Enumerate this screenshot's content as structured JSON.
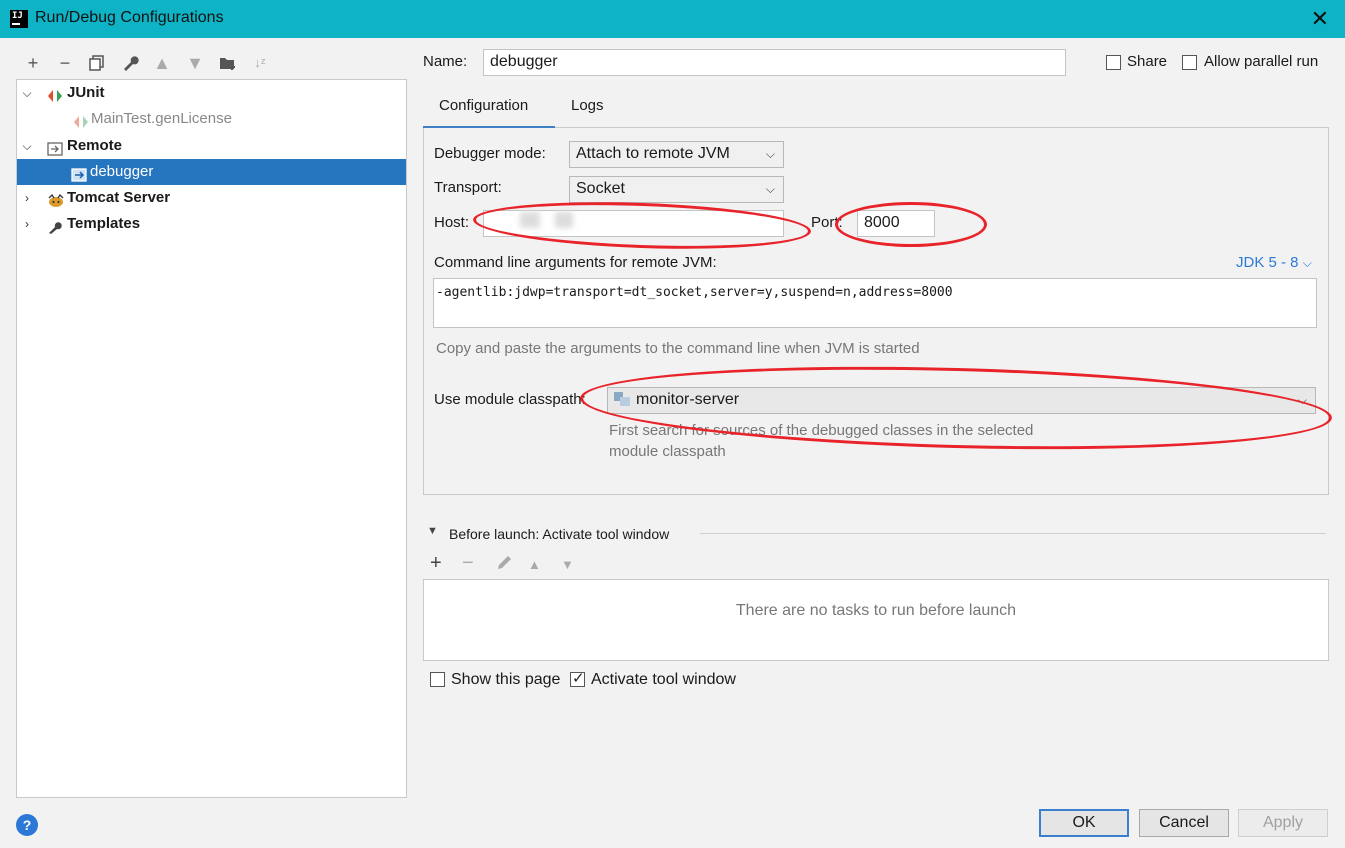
{
  "window": {
    "title": "Run/Debug Configurations",
    "app_icon": "IJ"
  },
  "left_toolbar": {
    "icons": [
      "add-icon",
      "remove-icon",
      "copy-icon",
      "wrench-icon",
      "move-up-icon",
      "move-down-icon",
      "folder-add-icon",
      "sort-icon"
    ]
  },
  "tree": {
    "items": [
      {
        "label": "JUnit",
        "bold": true,
        "expanded": true,
        "icon": "junit-icon"
      },
      {
        "label": "MainTest.genLicense",
        "bold": false,
        "icon": "junit-test-icon"
      },
      {
        "label": "Remote",
        "bold": true,
        "expanded": true,
        "icon": "remote-icon"
      },
      {
        "label": "debugger",
        "bold": false,
        "selected": true,
        "icon": "remote-config-icon"
      },
      {
        "label": "Tomcat Server",
        "bold": true,
        "expanded": false,
        "icon": "tomcat-icon"
      },
      {
        "label": "Templates",
        "bold": true,
        "expanded": false,
        "icon": "wrench-icon"
      }
    ]
  },
  "name_field": {
    "label": "Name:",
    "value": "debugger"
  },
  "share": {
    "label": "Share",
    "checked": false
  },
  "parallel": {
    "label": "Allow parallel run",
    "checked": false
  },
  "tabs": [
    {
      "label": "Configuration",
      "active": true
    },
    {
      "label": "Logs",
      "active": false
    }
  ],
  "config": {
    "debugger_mode_label": "Debugger mode:",
    "debugger_mode_value": "Attach to remote JVM",
    "transport_label": "Transport:",
    "transport_value": "Socket",
    "host_label": "Host:",
    "host_value": "",
    "port_label": "Port:",
    "port_value": "8000",
    "cmd_label": "Command line arguments for remote JVM:",
    "jdk_link": "JDK 5 - 8",
    "cmd_value": "-agentlib:jdwp=transport=dt_socket,server=y,suspend=n,address=8000",
    "cmd_hint": "Copy and paste the arguments to the command line when JVM is started",
    "module_label": "Use module classpath:",
    "module_value": "monitor-server",
    "module_hint_1": "First search for sources of the debugged classes in the selected",
    "module_hint_2": "module classpath"
  },
  "before_launch": {
    "title": "Before launch: Activate tool window",
    "empty_text": "There are no tasks to run before launch",
    "icons": [
      "add-icon",
      "remove-icon",
      "edit-icon",
      "move-up-icon",
      "move-down-icon"
    ]
  },
  "options": {
    "show_page_label": "Show this page",
    "show_page_checked": false,
    "activate_label": "Activate tool window",
    "activate_checked": true
  },
  "buttons": {
    "ok": "OK",
    "cancel": "Cancel",
    "apply": "Apply"
  },
  "colors": {
    "titlebar": "#0fb3c6",
    "selection": "#2675bf",
    "annotation": "#e8232a"
  }
}
